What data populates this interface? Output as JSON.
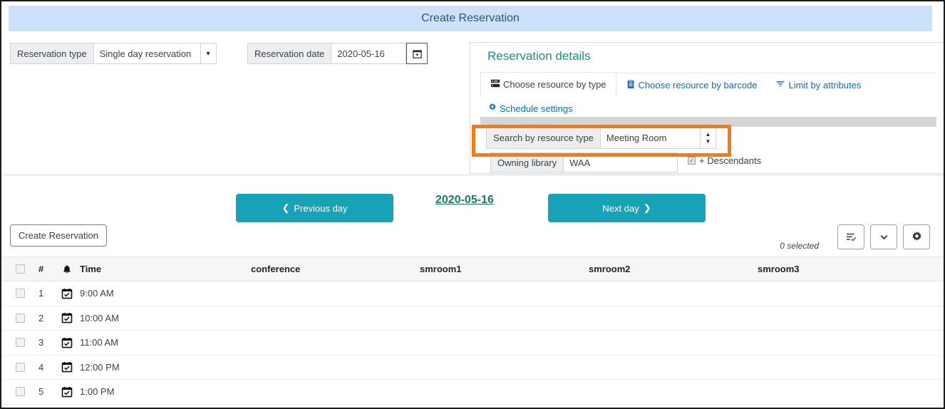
{
  "banner": {
    "title": "Create Reservation"
  },
  "topbar": {
    "reservation_type_label": "Reservation type",
    "reservation_type_value": "Single day reservation",
    "reservation_date_label": "Reservation date",
    "reservation_date_value": "2020-05-16",
    "calendar_icon": "calendar-icon"
  },
  "panel": {
    "title": "Reservation details",
    "tabs": [
      {
        "label": "Choose resource by type",
        "icon": "server-rack-icon",
        "active": true
      },
      {
        "label": "Choose resource by barcode",
        "icon": "clipboard-icon",
        "active": false
      },
      {
        "label": "Limit by attributes",
        "icon": "filter-icon",
        "active": false
      }
    ],
    "schedule_settings": {
      "label": "Schedule settings",
      "icon": "gear-icon"
    },
    "search_by_resource_type_label": "Search by resource type",
    "search_by_resource_type_value": "Meeting Room",
    "owning_library_label": "Owning library",
    "owning_library_value": "WAA",
    "descendants_label": "+ Descendants",
    "descendants_checked": true,
    "highlight_color": "#f07d18"
  },
  "daynav": {
    "previous_day": "Previous day",
    "next_day": "Next day",
    "current_date": "2020-05-16",
    "button_color": "#17a2b8"
  },
  "actions": {
    "create_reservation": "Create Reservation",
    "selected_count": "0 selected",
    "buttons": [
      {
        "name": "row-actions-icon"
      },
      {
        "name": "chevron-down-icon"
      },
      {
        "name": "gear-icon"
      }
    ]
  },
  "table": {
    "columns": [
      "",
      "#",
      "",
      "Time",
      "conference",
      "smroom1",
      "smroom2",
      "smroom3"
    ],
    "header_icons": {
      "select_all": "checkbox-icon",
      "bell": "bell-icon"
    },
    "rows": [
      {
        "num": "1",
        "icon": "calendar-check-icon",
        "time": "9:00 AM",
        "conference": "",
        "smroom1": "",
        "smroom2": "",
        "smroom3": ""
      },
      {
        "num": "2",
        "icon": "calendar-check-icon",
        "time": "10:00 AM",
        "conference": "",
        "smroom1": "",
        "smroom2": "",
        "smroom3": ""
      },
      {
        "num": "3",
        "icon": "calendar-check-icon",
        "time": "11:00 AM",
        "conference": "",
        "smroom1": "",
        "smroom2": "",
        "smroom3": ""
      },
      {
        "num": "4",
        "icon": "calendar-check-icon",
        "time": "12:00 PM",
        "conference": "",
        "smroom1": "",
        "smroom2": "",
        "smroom3": ""
      },
      {
        "num": "5",
        "icon": "calendar-check-icon",
        "time": "1:00 PM",
        "conference": "",
        "smroom1": "",
        "smroom2": "",
        "smroom3": ""
      }
    ]
  }
}
